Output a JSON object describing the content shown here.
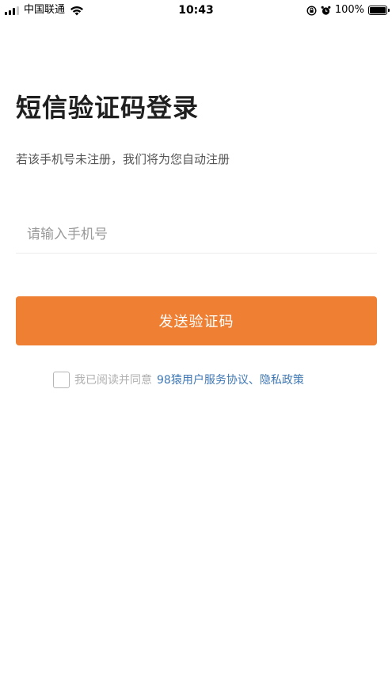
{
  "status_bar": {
    "carrier": "中国联通",
    "time": "10:43",
    "battery": "100%",
    "battery_level": 1.0,
    "icons": [
      "signal-icon",
      "wifi-icon",
      "orientation-lock-icon",
      "alarm-icon",
      "battery-icon"
    ]
  },
  "login": {
    "title": "短信验证码登录",
    "subtitle": "若该手机号未注册，我们将为您自动注册",
    "phone_placeholder": "请输入手机号",
    "phone_value": "",
    "send_button": "发送验证码",
    "agreement_prefix": "我已阅读并同意",
    "agreement_link": "98猿用户服务协议、隐私政策",
    "agreement_checked": false
  },
  "colors": {
    "accent": "#ee7f33",
    "link": "#3f78b5",
    "title": "#1f1f1f",
    "muted": "#9a9a9a"
  }
}
